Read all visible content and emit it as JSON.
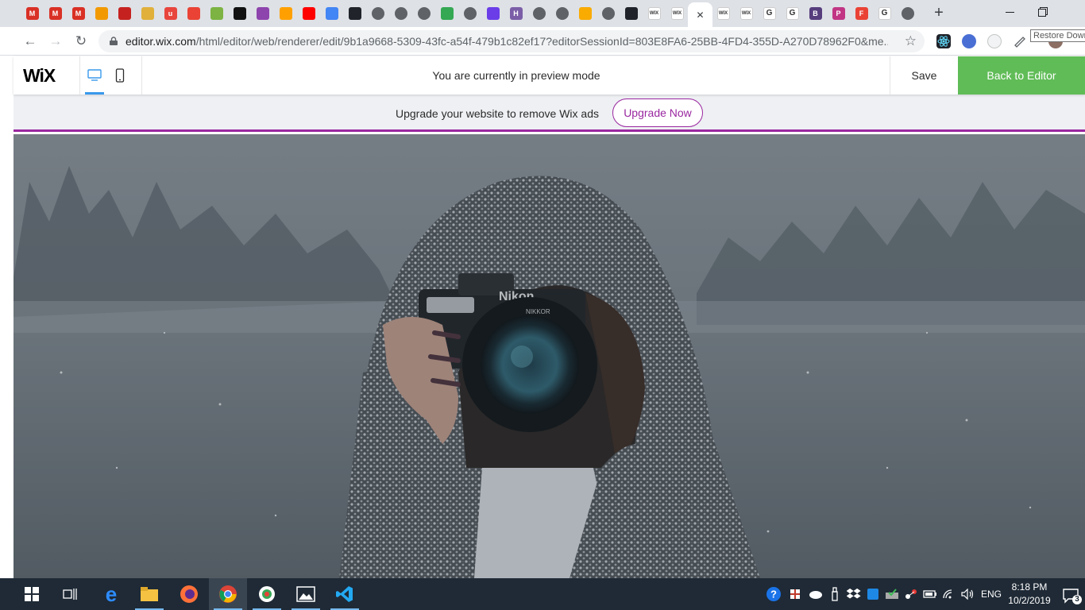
{
  "browser": {
    "tabs": [
      {
        "icon": "gmail-icon",
        "glyph": "M",
        "color": "#d93025"
      },
      {
        "icon": "gmail-icon",
        "glyph": "M",
        "color": "#d93025"
      },
      {
        "icon": "gmail-icon",
        "glyph": "M",
        "color": "#d93025"
      },
      {
        "icon": "orange-app-icon",
        "glyph": "",
        "color": "#f29900"
      },
      {
        "icon": "red-app-icon",
        "glyph": "",
        "color": "#c5221f"
      },
      {
        "icon": "emoji-icon",
        "glyph": "",
        "color": "#e0b03a"
      },
      {
        "icon": "script-icon",
        "glyph": "u",
        "color": "#e8453c"
      },
      {
        "icon": "store-icon",
        "glyph": "",
        "color": "#ea4335"
      },
      {
        "icon": "chat-icon",
        "glyph": "",
        "color": "#7cb342"
      },
      {
        "icon": "github-icon",
        "glyph": "",
        "color": "#111111"
      },
      {
        "icon": "purple-stack-icon",
        "glyph": "",
        "color": "#8e44ad"
      },
      {
        "icon": "firebase-icon",
        "glyph": "",
        "color": "#ffa000"
      },
      {
        "icon": "youtube-icon",
        "glyph": "",
        "color": "#ff0000"
      },
      {
        "icon": "chrome-colorful-icon",
        "glyph": "",
        "color": "#4285f4"
      },
      {
        "icon": "react-icon",
        "glyph": "",
        "color": "#20232a"
      },
      {
        "icon": "globe-icon",
        "glyph": "",
        "color": "#5f6368"
      },
      {
        "icon": "globe-icon",
        "glyph": "",
        "color": "#5f6368"
      },
      {
        "icon": "globe-icon",
        "glyph": "",
        "color": "#5f6368"
      },
      {
        "icon": "tree-icon",
        "glyph": "",
        "color": "#34a853"
      },
      {
        "icon": "globe-icon",
        "glyph": "",
        "color": "#5f6368"
      },
      {
        "icon": "slash-icon",
        "glyph": "",
        "color": "#6a3de8"
      },
      {
        "icon": "h-icon",
        "glyph": "H",
        "color": "#7b5ea7"
      },
      {
        "icon": "globe-icon",
        "glyph": "",
        "color": "#5f6368"
      },
      {
        "icon": "globe-icon",
        "glyph": "",
        "color": "#5f6368"
      },
      {
        "icon": "analytics-icon",
        "glyph": "",
        "color": "#f9ab00"
      },
      {
        "icon": "globe-icon",
        "glyph": "",
        "color": "#5f6368"
      },
      {
        "icon": "react-icon",
        "glyph": "",
        "color": "#20232a"
      },
      {
        "icon": "wix-icon",
        "glyph": "WIX",
        "color": "#ffffff"
      },
      {
        "icon": "wix-icon",
        "glyph": "WIX",
        "color": "#ffffff"
      },
      {
        "icon": "wix-icon",
        "glyph": "WIX",
        "color": "#ffffff"
      },
      {
        "icon": "wix-icon",
        "glyph": "WIX",
        "color": "#ffffff"
      },
      {
        "icon": "google-icon",
        "glyph": "G",
        "color": "#ffffff"
      },
      {
        "icon": "google-icon",
        "glyph": "G",
        "color": "#ffffff"
      },
      {
        "icon": "bootstrap-icon",
        "glyph": "B",
        "color": "#563d7c"
      },
      {
        "icon": "pinterest-like-icon",
        "glyph": "P",
        "color": "#c13584"
      },
      {
        "icon": "f-icon",
        "glyph": "F",
        "color": "#ea4335"
      },
      {
        "icon": "google-icon",
        "glyph": "G",
        "color": "#ffffff"
      },
      {
        "icon": "globe-icon",
        "glyph": "",
        "color": "#5f6368"
      }
    ],
    "active_tab_index": 28,
    "close_glyph": "✕",
    "new_tab_glyph": "+",
    "tooltip": "Restore Down",
    "url_host": "editor.wix.com",
    "url_path": "/html/editor/web/renderer/edit/9b1a9668-5309-43fc-a54f-479b1c82ef17?editorSessionId=803E8FA6-25BB-4FD4-355D-A270D78962F0&me...",
    "back_glyph": "←",
    "forward_glyph": "→",
    "reload_glyph": "↻",
    "star_glyph": "☆"
  },
  "wix_bar": {
    "logo": "WiX",
    "preview_message": "You are currently in preview mode",
    "save_label": "Save",
    "back_label": "Back to Editor"
  },
  "upgrade_banner": {
    "message": "Upgrade your website to remove Wix ads",
    "button_label": "Upgrade Now"
  },
  "hero": {
    "camera_brand": "Nikon",
    "lens_text": "NIKKOR"
  },
  "taskbar": {
    "language": "ENG",
    "time": "8:18 PM",
    "date": "10/2/2019",
    "notification_count": "3"
  },
  "colors": {
    "wix_green": "#60bc57",
    "wix_purple": "#9a27a0",
    "wix_blue": "#3899ec",
    "taskbar": "#1f2a36"
  }
}
